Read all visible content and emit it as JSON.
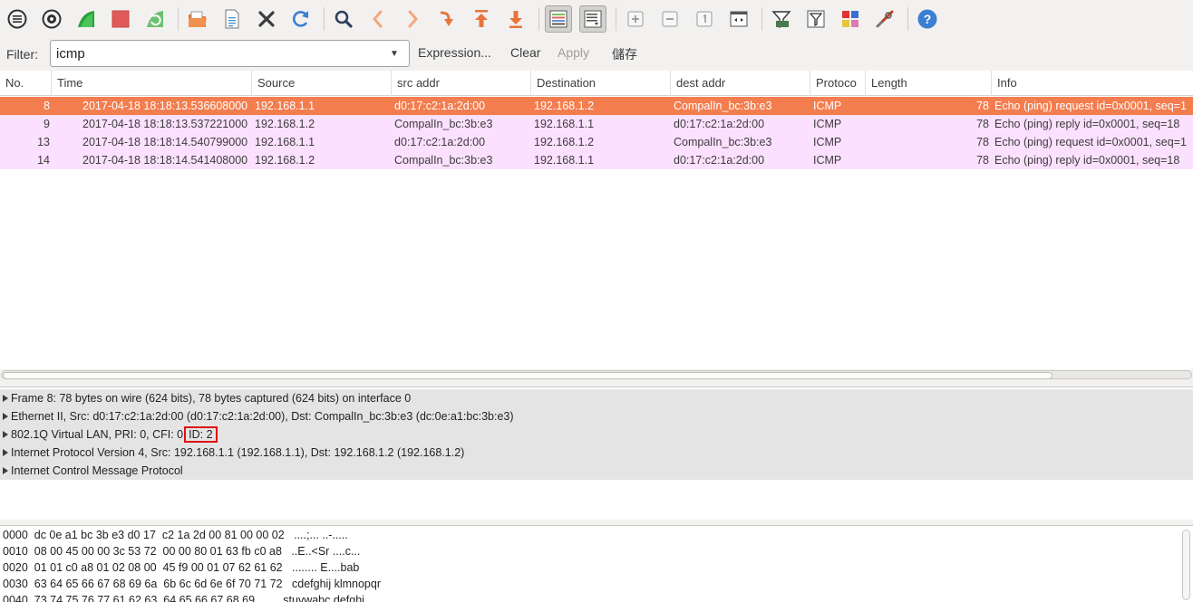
{
  "toolbar": {
    "icons": [
      "list-interfaces-icon",
      "capture-options-icon",
      "start-capture-icon",
      "stop-capture-icon",
      "restart-capture-icon",
      "open-file-icon",
      "save-file-icon",
      "close-file-icon",
      "reload-icon",
      "find-packet-icon",
      "go-back-icon",
      "go-forward-icon",
      "go-to-packet-icon",
      "go-first-packet-icon",
      "go-last-packet-icon",
      "colorize-list-icon",
      "auto-scroll-icon",
      "zoom-in-icon",
      "zoom-out-icon",
      "normal-size-icon",
      "resize-columns-icon",
      "capture-filters-icon",
      "display-filters-icon",
      "coloring-rules-icon",
      "preferences-icon",
      "help-icon"
    ]
  },
  "filter": {
    "label": "Filter:",
    "value": "icmp",
    "expression_label": "Expression...",
    "clear_label": "Clear",
    "apply_label": "Apply",
    "save_label": "儲存"
  },
  "packet_list": {
    "columns": [
      "No.",
      "Time",
      "Source",
      "src addr",
      "Destination",
      "dest addr",
      "Protoco",
      "Length",
      "Info"
    ],
    "rows": [
      {
        "no": "8",
        "time": "2017-04-18 18:18:13.536608000",
        "source": "192.168.1.1",
        "src_addr": "d0:17:c2:1a:2d:00",
        "destination": "192.168.1.2",
        "dest_addr": "CompalIn_bc:3b:e3",
        "protocol": "ICMP",
        "length": "78",
        "info": "Echo (ping) request  id=0x0001, seq=1"
      },
      {
        "no": "9",
        "time": "2017-04-18 18:18:13.537221000",
        "source": "192.168.1.2",
        "src_addr": "CompalIn_bc:3b:e3",
        "destination": "192.168.1.1",
        "dest_addr": "d0:17:c2:1a:2d:00",
        "protocol": "ICMP",
        "length": "78",
        "info": "Echo (ping) reply    id=0x0001, seq=18"
      },
      {
        "no": "13",
        "time": "2017-04-18 18:18:14.540799000",
        "source": "192.168.1.1",
        "src_addr": "d0:17:c2:1a:2d:00",
        "destination": "192.168.1.2",
        "dest_addr": "CompalIn_bc:3b:e3",
        "protocol": "ICMP",
        "length": "78",
        "info": "Echo (ping) request  id=0x0001, seq=1"
      },
      {
        "no": "14",
        "time": "2017-04-18 18:18:14.541408000",
        "source": "192.168.1.2",
        "src_addr": "CompalIn_bc:3b:e3",
        "destination": "192.168.1.1",
        "dest_addr": "d0:17:c2:1a:2d:00",
        "protocol": "ICMP",
        "length": "78",
        "info": "Echo (ping) reply    id=0x0001, seq=18"
      }
    ],
    "colors": {
      "selected_row": "#f37d4e",
      "icmp_row": "#fce0ff"
    }
  },
  "details": {
    "frame": "Frame 8: 78 bytes on wire (624 bits), 78 bytes captured (624 bits) on interface 0",
    "ethernet": "Ethernet II, Src: d0:17:c2:1a:2d:00 (d0:17:c2:1a:2d:00), Dst: CompalIn_bc:3b:e3 (dc:0e:a1:bc:3b:e3)",
    "vlan_prefix": "802.1Q Virtual LAN, PRI: 0, CFI: 0",
    "vlan_id": "ID: 2",
    "ip": "Internet Protocol Version 4, Src: 192.168.1.1 (192.168.1.1), Dst: 192.168.1.2 (192.168.1.2)",
    "icmp": "Internet Control Message Protocol"
  },
  "hex": {
    "rows": [
      "0000  dc 0e a1 bc 3b e3 d0 17  c2 1a 2d 00 81 00 00 02   ....;... ..-.....",
      "0010  08 00 45 00 00 3c 53 72  00 00 80 01 63 fb c0 a8   ..E..<Sr ....c...",
      "0020  01 01 c0 a8 01 02 08 00  45 f9 00 01 07 62 61 62   ........ E....bab",
      "0030  63 64 65 66 67 68 69 6a  6b 6c 6d 6e 6f 70 71 72   cdefghij klmnopqr",
      "0040  73 74 75 76 77 61 62 63  64 65 66 67 68 69         stuvwabc defghi"
    ]
  }
}
